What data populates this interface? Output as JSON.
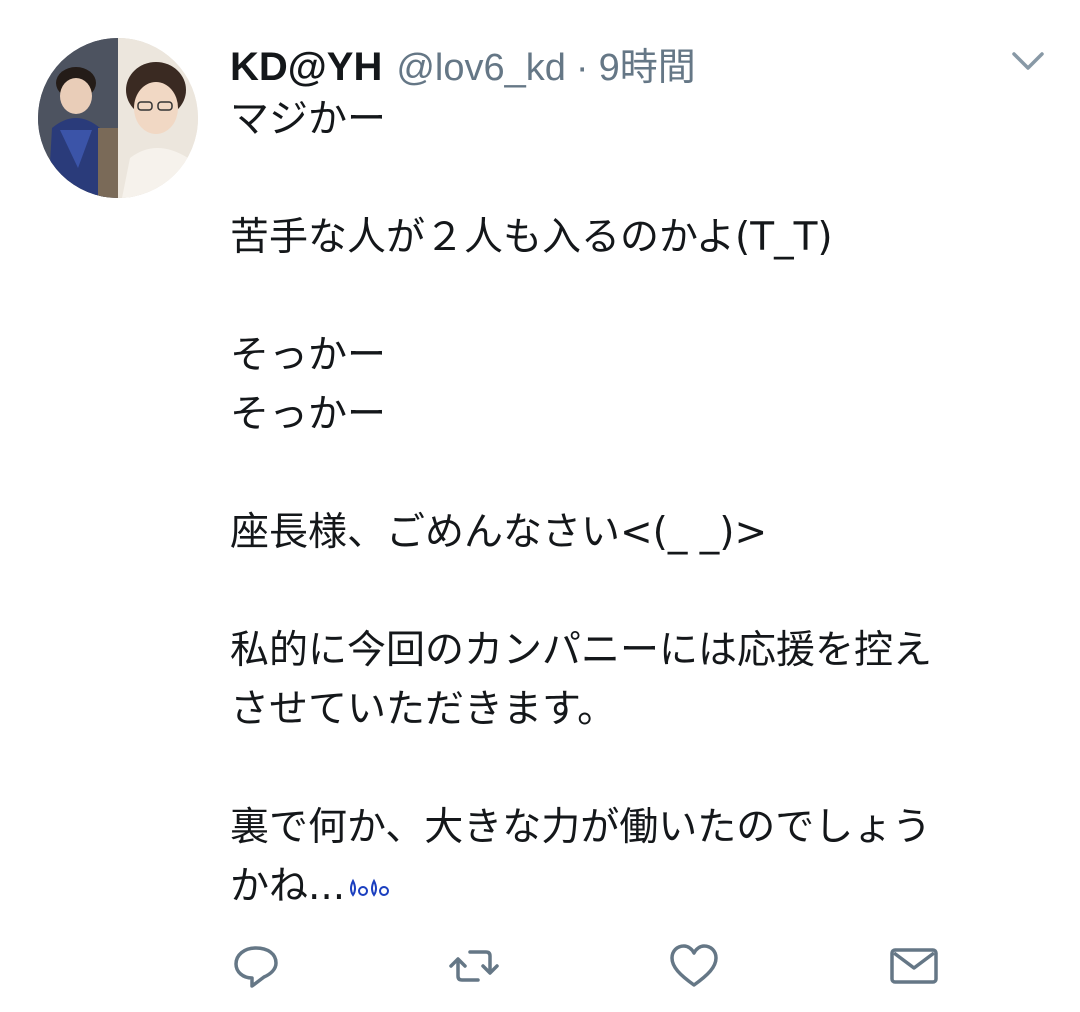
{
  "tweet": {
    "display_name": "KD@YH",
    "handle": "@lov6_kd",
    "separator": "·",
    "time": "9時間",
    "lines": [
      "マジかー",
      "",
      "苦手な人が２人も入るのかよ(T_T)",
      "",
      "そっかー",
      "そっかー",
      "",
      "座長様、ごめんなさい<(_ _)>",
      "",
      "私的に今回のカンパニーには応援を控え",
      "させていただきます。",
      "",
      "裏で何か、大きな力が働いたのでしょう",
      "かね..."
    ],
    "trailing_icon": "sweat-drops-icon"
  },
  "icons": {
    "menu": "chevron-down-icon",
    "reply": "reply-icon",
    "retweet": "retweet-icon",
    "like": "heart-icon",
    "dm": "envelope-icon"
  },
  "colors": {
    "text": "#14171a",
    "secondary": "#657786",
    "icon": "#657786",
    "emoji_blue": "#1b3fbf"
  }
}
